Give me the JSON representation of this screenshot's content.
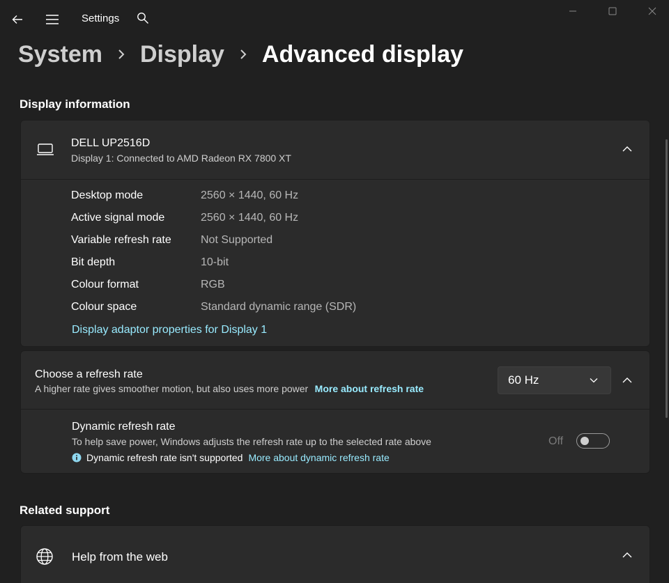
{
  "app": {
    "title": "Settings"
  },
  "breadcrumb": {
    "items": [
      "System",
      "Display",
      "Advanced display"
    ]
  },
  "display_information": {
    "heading": "Display information",
    "monitor": {
      "name": "DELL UP2516D",
      "subtitle": "Display 1: Connected to AMD Radeon RX 7800 XT"
    },
    "rows": [
      {
        "label": "Desktop mode",
        "value": "2560 × 1440, 60 Hz"
      },
      {
        "label": "Active signal mode",
        "value": "2560 × 1440, 60 Hz"
      },
      {
        "label": "Variable refresh rate",
        "value": "Not Supported"
      },
      {
        "label": "Bit depth",
        "value": "10-bit"
      },
      {
        "label": "Colour format",
        "value": "RGB"
      },
      {
        "label": "Colour space",
        "value": "Standard dynamic range (SDR)"
      }
    ],
    "adaptor_link": "Display adaptor properties for Display 1"
  },
  "refresh_rate": {
    "title": "Choose a refresh rate",
    "description": "A higher rate gives smoother motion, but also uses more power",
    "more_link": "More about refresh rate",
    "selected": "60 Hz",
    "dynamic": {
      "title": "Dynamic refresh rate",
      "description": "To help save power, Windows adjusts the refresh rate up to the selected rate above",
      "not_supported": "Dynamic refresh rate isn't supported",
      "more_link": "More about dynamic refresh rate",
      "toggle_label": "Off",
      "toggle_on": false
    }
  },
  "related_support": {
    "heading": "Related support",
    "help_title": "Help from the web"
  },
  "icons": {
    "back": "back-arrow-icon",
    "menu": "hamburger-menu-icon",
    "search": "search-icon",
    "monitor": "laptop-icon",
    "info": "info-icon",
    "globe": "globe-icon"
  },
  "colors": {
    "background": "#202020",
    "card": "#2b2b2b",
    "accent_link": "#99ebff"
  }
}
